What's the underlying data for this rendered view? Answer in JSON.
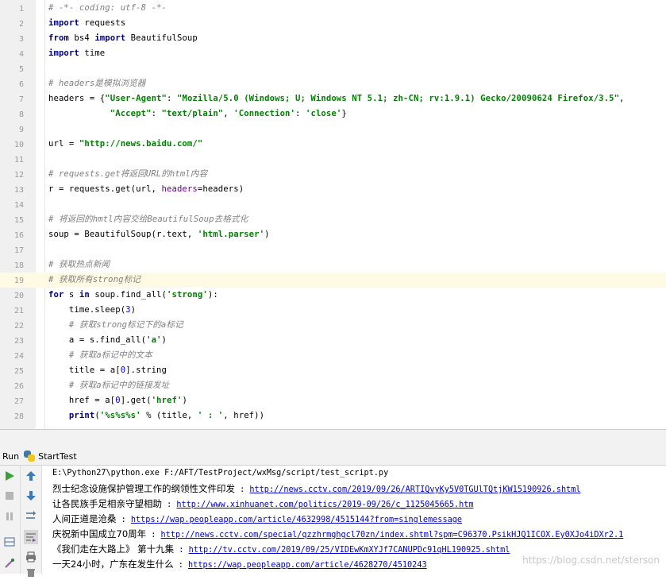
{
  "editor": {
    "current_line": 19,
    "lines": [
      {
        "n": "1",
        "tokens": [
          {
            "t": "# -*- coding: utf-8 -*-",
            "c": "cm"
          }
        ]
      },
      {
        "n": "2",
        "tokens": [
          {
            "t": "import",
            "c": "kw"
          },
          {
            "t": " requests",
            "c": ""
          }
        ]
      },
      {
        "n": "3",
        "tokens": [
          {
            "t": "from",
            "c": "kw"
          },
          {
            "t": " bs4 ",
            "c": ""
          },
          {
            "t": "import",
            "c": "kw"
          },
          {
            "t": " BeautifulSoup",
            "c": ""
          }
        ]
      },
      {
        "n": "4",
        "tokens": [
          {
            "t": "import",
            "c": "kw"
          },
          {
            "t": " time",
            "c": ""
          }
        ]
      },
      {
        "n": "5",
        "tokens": []
      },
      {
        "n": "6",
        "tokens": [
          {
            "t": "# headers是模拟浏览器",
            "c": "cm"
          }
        ]
      },
      {
        "n": "7",
        "tokens": [
          {
            "t": "headers = {",
            "c": ""
          },
          {
            "t": "\"User-Agent\"",
            "c": "str"
          },
          {
            "t": ": ",
            "c": ""
          },
          {
            "t": "\"Mozilla/5.0 (Windows; U; Windows NT 5.1; zh-CN; rv:1.9.1) Gecko/20090624 Firefox/3.5\"",
            "c": "str"
          },
          {
            "t": ",",
            "c": ""
          }
        ]
      },
      {
        "n": "8",
        "tokens": [
          {
            "t": "            ",
            "c": ""
          },
          {
            "t": "\"Accept\"",
            "c": "str"
          },
          {
            "t": ": ",
            "c": ""
          },
          {
            "t": "\"text/plain\"",
            "c": "str"
          },
          {
            "t": ", ",
            "c": ""
          },
          {
            "t": "'Connection'",
            "c": "str"
          },
          {
            "t": ": ",
            "c": ""
          },
          {
            "t": "'close'",
            "c": "str"
          },
          {
            "t": "}",
            "c": ""
          }
        ]
      },
      {
        "n": "9",
        "tokens": []
      },
      {
        "n": "10",
        "tokens": [
          {
            "t": "url = ",
            "c": ""
          },
          {
            "t": "\"http://news.baidu.com/\"",
            "c": "str"
          }
        ]
      },
      {
        "n": "11",
        "tokens": []
      },
      {
        "n": "12",
        "tokens": [
          {
            "t": "# requests.get将返回URL的html内容",
            "c": "cm"
          }
        ]
      },
      {
        "n": "13",
        "tokens": [
          {
            "t": "r = requests.get(url, ",
            "c": ""
          },
          {
            "t": "headers",
            "c": "kwarg"
          },
          {
            "t": "=headers)",
            "c": ""
          }
        ]
      },
      {
        "n": "14",
        "tokens": []
      },
      {
        "n": "15",
        "tokens": [
          {
            "t": "# 将返回的hmtl内容交给BeautifulSoup去格式化",
            "c": "cm"
          }
        ]
      },
      {
        "n": "16",
        "tokens": [
          {
            "t": "soup = BeautifulSoup(r.text, ",
            "c": ""
          },
          {
            "t": "'html.parser'",
            "c": "str"
          },
          {
            "t": ")",
            "c": ""
          }
        ]
      },
      {
        "n": "17",
        "tokens": []
      },
      {
        "n": "18",
        "tokens": [
          {
            "t": "# 获取热点新闻",
            "c": "cm"
          }
        ]
      },
      {
        "n": "19",
        "tokens": [
          {
            "t": "# 获取所有strong标记",
            "c": "cm"
          }
        ]
      },
      {
        "n": "20",
        "tokens": [
          {
            "t": "for",
            "c": "kw"
          },
          {
            "t": " s ",
            "c": ""
          },
          {
            "t": "in",
            "c": "kw"
          },
          {
            "t": " soup.find_all(",
            "c": ""
          },
          {
            "t": "'strong'",
            "c": "str"
          },
          {
            "t": "):",
            "c": ""
          }
        ]
      },
      {
        "n": "21",
        "tokens": [
          {
            "t": "    time.sleep(",
            "c": ""
          },
          {
            "t": "3",
            "c": "num"
          },
          {
            "t": ")",
            "c": ""
          }
        ]
      },
      {
        "n": "22",
        "tokens": [
          {
            "t": "    ",
            "c": ""
          },
          {
            "t": "# 获取strong标记下的a标记",
            "c": "cm"
          }
        ]
      },
      {
        "n": "23",
        "tokens": [
          {
            "t": "    a = s.find_all(",
            "c": ""
          },
          {
            "t": "'a'",
            "c": "str"
          },
          {
            "t": ")",
            "c": ""
          }
        ]
      },
      {
        "n": "24",
        "tokens": [
          {
            "t": "    ",
            "c": ""
          },
          {
            "t": "# 获取a标记中的文本",
            "c": "cm"
          }
        ]
      },
      {
        "n": "25",
        "tokens": [
          {
            "t": "    title = a[",
            "c": ""
          },
          {
            "t": "0",
            "c": "num"
          },
          {
            "t": "].string",
            "c": ""
          }
        ]
      },
      {
        "n": "26",
        "tokens": [
          {
            "t": "    ",
            "c": ""
          },
          {
            "t": "# 获取a标记中的链接发址",
            "c": "cm"
          }
        ]
      },
      {
        "n": "27",
        "tokens": [
          {
            "t": "    href = a[",
            "c": ""
          },
          {
            "t": "0",
            "c": "num"
          },
          {
            "t": "].get(",
            "c": ""
          },
          {
            "t": "'href'",
            "c": "str"
          },
          {
            "t": ")",
            "c": ""
          }
        ]
      },
      {
        "n": "28",
        "tokens": [
          {
            "t": "    ",
            "c": ""
          },
          {
            "t": "print",
            "c": "kw"
          },
          {
            "t": "(",
            "c": ""
          },
          {
            "t": "'%s%s%s'",
            "c": "str"
          },
          {
            "t": " % (title, ",
            "c": ""
          },
          {
            "t": "' : '",
            "c": "str"
          },
          {
            "t": ", href))",
            "c": ""
          }
        ]
      }
    ]
  },
  "run": {
    "label": "Run",
    "config_name": "StartTest",
    "command": "E:\\Python27\\python.exe F:/AFT/TestProject/wxMsg/script/test_script.py",
    "output": [
      {
        "title": "烈士纪念设施保护管理工作的纲领性文件印发",
        "sep": " : ",
        "link": "http://news.cctv.com/2019/09/26/ARTIQvyKy5V0TGUlTQtjKW15190926.shtml"
      },
      {
        "title": "让各民族手足相亲守望相助",
        "sep": " : ",
        "link": "http://www.xinhuanet.com/politics/2019-09/26/c_1125045665.htm"
      },
      {
        "title": "人间正道是沧桑",
        "sep": " : ",
        "link": "https://wap.peopleapp.com/article/4632998/4515144?from=singlemessage"
      },
      {
        "title": "庆祝新中国成立70周年",
        "sep": " : ",
        "link": "http://news.cctv.com/special/qzzhrmghgcl70zn/index.shtml?spm=C96370.PsikHJQ1ICOX.Ey0XJo4iDXr2.1"
      },
      {
        "title": "《我们走在大路上》 第十九集",
        "sep": " : ",
        "link": "http://tv.cctv.com/2019/09/25/VIDEwKmXYJf7CANUPDc91qHL190925.shtml"
      },
      {
        "title": "一天24小时，广东在发生什么",
        "sep": " : ",
        "link": "https://wap.peopleapp.com/article/4628270/4510243"
      }
    ],
    "watermark": "https://blog.csdn.net/sterson"
  },
  "toolbar_icons": [
    "run-icon",
    "stop-icon",
    "pause-icon",
    "layout-icon",
    "debug-icon",
    "up-arrow-icon",
    "down-arrow-icon",
    "rerun-icon",
    "soft-wrap-icon",
    "print-icon",
    "trash-icon"
  ]
}
